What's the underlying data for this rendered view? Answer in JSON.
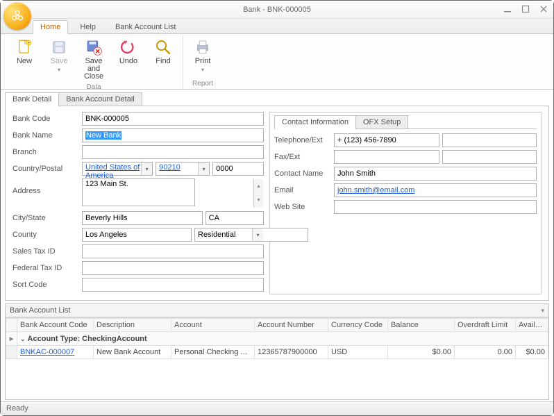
{
  "window": {
    "title": "Bank - BNK-000005"
  },
  "menuTabs": {
    "home": "Home",
    "help": "Help",
    "bankAccountList": "Bank Account List"
  },
  "ribbon": {
    "new": "New",
    "save": "Save",
    "saveClose": "Save and\nClose",
    "undo": "Undo",
    "find": "Find",
    "print": "Print",
    "groupData": "Data",
    "groupReport": "Report"
  },
  "tabs": {
    "bankDetail": "Bank Detail",
    "bankAccountDetail": "Bank Account Detail"
  },
  "labels": {
    "bankCode": "Bank Code",
    "bankName": "Bank Name",
    "branch": "Branch",
    "countryPostal": "Country/Postal",
    "address": "Address",
    "cityState": "City/State",
    "county": "County",
    "salesTaxId": "Sales Tax ID",
    "federalTaxId": "Federal Tax ID",
    "sortCode": "Sort Code"
  },
  "values": {
    "bankCode": "BNK-000005",
    "bankName": "New Bank",
    "branch": "",
    "country": "United States of America",
    "postal1": "90210",
    "postal2": "0000",
    "address": "123 Main St.",
    "city": "Beverly Hills",
    "state": "CA",
    "county": "Los Angeles",
    "addrType": "Residential",
    "salesTaxId": "",
    "federalTaxId": "",
    "sortCode": ""
  },
  "contactTabs": {
    "contactInfo": "Contact Information",
    "ofx": "OFX Setup"
  },
  "contactLabels": {
    "telephone": "Telephone/Ext",
    "fax": "Fax/Ext",
    "contactName": "Contact Name",
    "email": "Email",
    "website": "Web Site"
  },
  "contactValues": {
    "telephone": "+ (123) 456-7890",
    "telephoneExt": "",
    "fax": "",
    "faxExt": "",
    "contactName": "John Smith",
    "email": "john.smith@email.com",
    "website": ""
  },
  "accountList": {
    "title": "Bank Account List",
    "columns": {
      "code": "Bank Account Code",
      "desc": "Description",
      "account": "Account",
      "acctNum": "Account Number",
      "currency": "Currency Code",
      "balance": "Balance",
      "overdraft": "Overdraft Limit",
      "available": "Available Funds"
    },
    "group": "Account Type: CheckingAccount",
    "rows": [
      {
        "code": "BNKAC-000007",
        "desc": "New Bank Account",
        "account": "Personal Checking Acc…",
        "acctNum": "12365787900000",
        "currency": "USD",
        "balance": "$0.00",
        "overdraft": "0.00",
        "available": "$0.00"
      }
    ]
  },
  "status": "Ready"
}
